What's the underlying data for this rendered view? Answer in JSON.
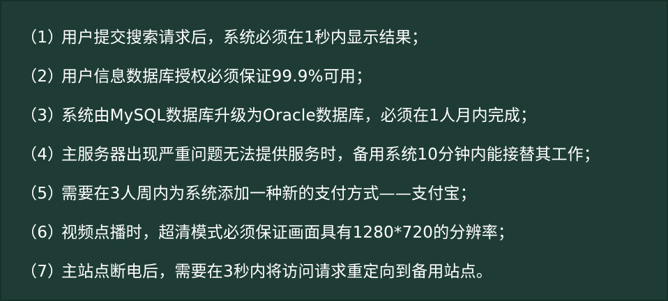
{
  "items": [
    {
      "num": "（1）",
      "text": "用户提交搜索请求后，系统必须在1秒内显示结果；"
    },
    {
      "num": "（2）",
      "text": "用户信息数据库授权必须保证99.9%可用；"
    },
    {
      "num": "（3）",
      "text": "系统由MySQL数据库升级为Oracle数据库，必须在1人月内完成；"
    },
    {
      "num": "（4）",
      "text": "主服务器出现严重问题无法提供服务时，备用系统10分钟内能接替其工作；"
    },
    {
      "num": "（5）",
      "text": "需要在3人周内为系统添加一种新的支付方式——支付宝；"
    },
    {
      "num": "（6）",
      "text": "视频点播时，超清模式必须保证画面具有1280*720的分辨率；"
    },
    {
      "num": "（7）",
      "text": "主站点断电后，需要在3秒内将访问请求重定向到备用站点。"
    }
  ]
}
